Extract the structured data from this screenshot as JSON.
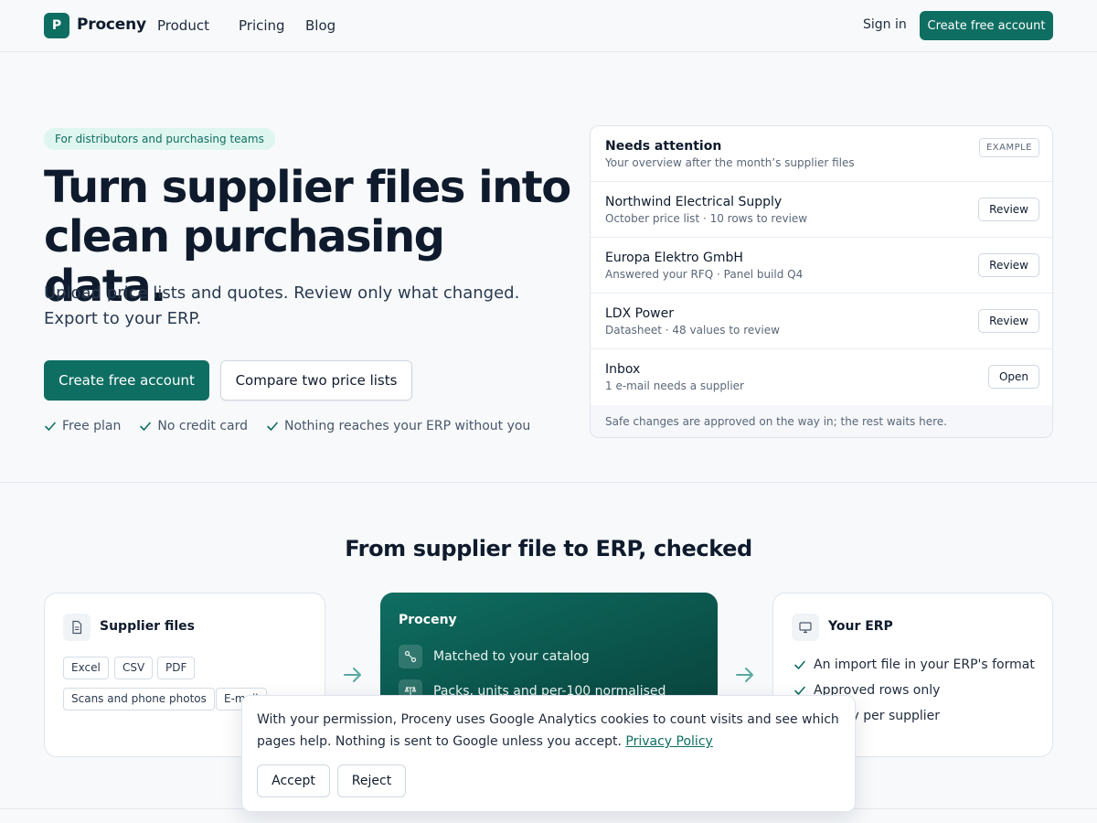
{
  "nav": {
    "logo_letter": "P",
    "brand": "Proceny",
    "links": [
      "Product",
      "Pricing",
      "Blog"
    ],
    "sign_in": "Sign in",
    "cta": "Create free account"
  },
  "hero": {
    "badge": "For distributors and purchasing teams",
    "title_line1": "Turn supplier files into",
    "title_line2": "clean purchasing data.",
    "subtitle": "Upload price lists and quotes. Review only what changed. Export to your ERP.",
    "primary_cta": "Create free account",
    "secondary_cta": "Compare two price lists",
    "checks": [
      "Free plan",
      "No credit card",
      "Nothing reaches your ERP without you"
    ]
  },
  "attention": {
    "title": "Needs attention",
    "subtitle": "Your overview after the month’s supplier files",
    "tag": "EXAMPLE",
    "rows": [
      {
        "title": "Northwind Electrical Supply",
        "sub": "October price list · 10 rows to review",
        "action": "Review"
      },
      {
        "title": "Europa Elektro GmbH",
        "sub": "Answered your RFQ · Panel build Q4",
        "action": "Review"
      },
      {
        "title": "LDX Power",
        "sub": "Datasheet · 48 values to review",
        "action": "Review"
      },
      {
        "title": "Inbox",
        "sub": "1 e-mail needs a supplier",
        "action": "Open"
      }
    ],
    "footer": "Safe changes are approved on the way in; the rest waits here."
  },
  "flow": {
    "title": "From supplier file to ERP, checked",
    "supplier": {
      "title": "Supplier files",
      "chips": [
        "Excel",
        "CSV",
        "PDF",
        "Scans and phone photos",
        "E-mail"
      ]
    },
    "proceny": {
      "title": "Proceny",
      "items": [
        "Matched to your catalog",
        "Packs, units and per-100 normalised"
      ]
    },
    "erp": {
      "title": "Your ERP",
      "items": [
        "An import file in your ERP's format",
        "Approved rows only",
        "History per supplier"
      ]
    }
  },
  "cookie": {
    "text": "With your permission, Proceny uses Google Analytics cookies to count visits and see which pages help. Nothing is sent to Google unless you accept.",
    "link": "Privacy Policy",
    "accept": "Accept",
    "reject": "Reject"
  },
  "colors": {
    "brand": "#0f6e62",
    "badge_bg": "#dff5ef",
    "page_bg": "#f7f9fb"
  },
  "icons": {
    "check": "check-icon",
    "file": "file-icon",
    "arrow": "arrow-right-icon",
    "link": "link-icon",
    "units": "scale-icon",
    "monitor": "monitor-icon"
  }
}
